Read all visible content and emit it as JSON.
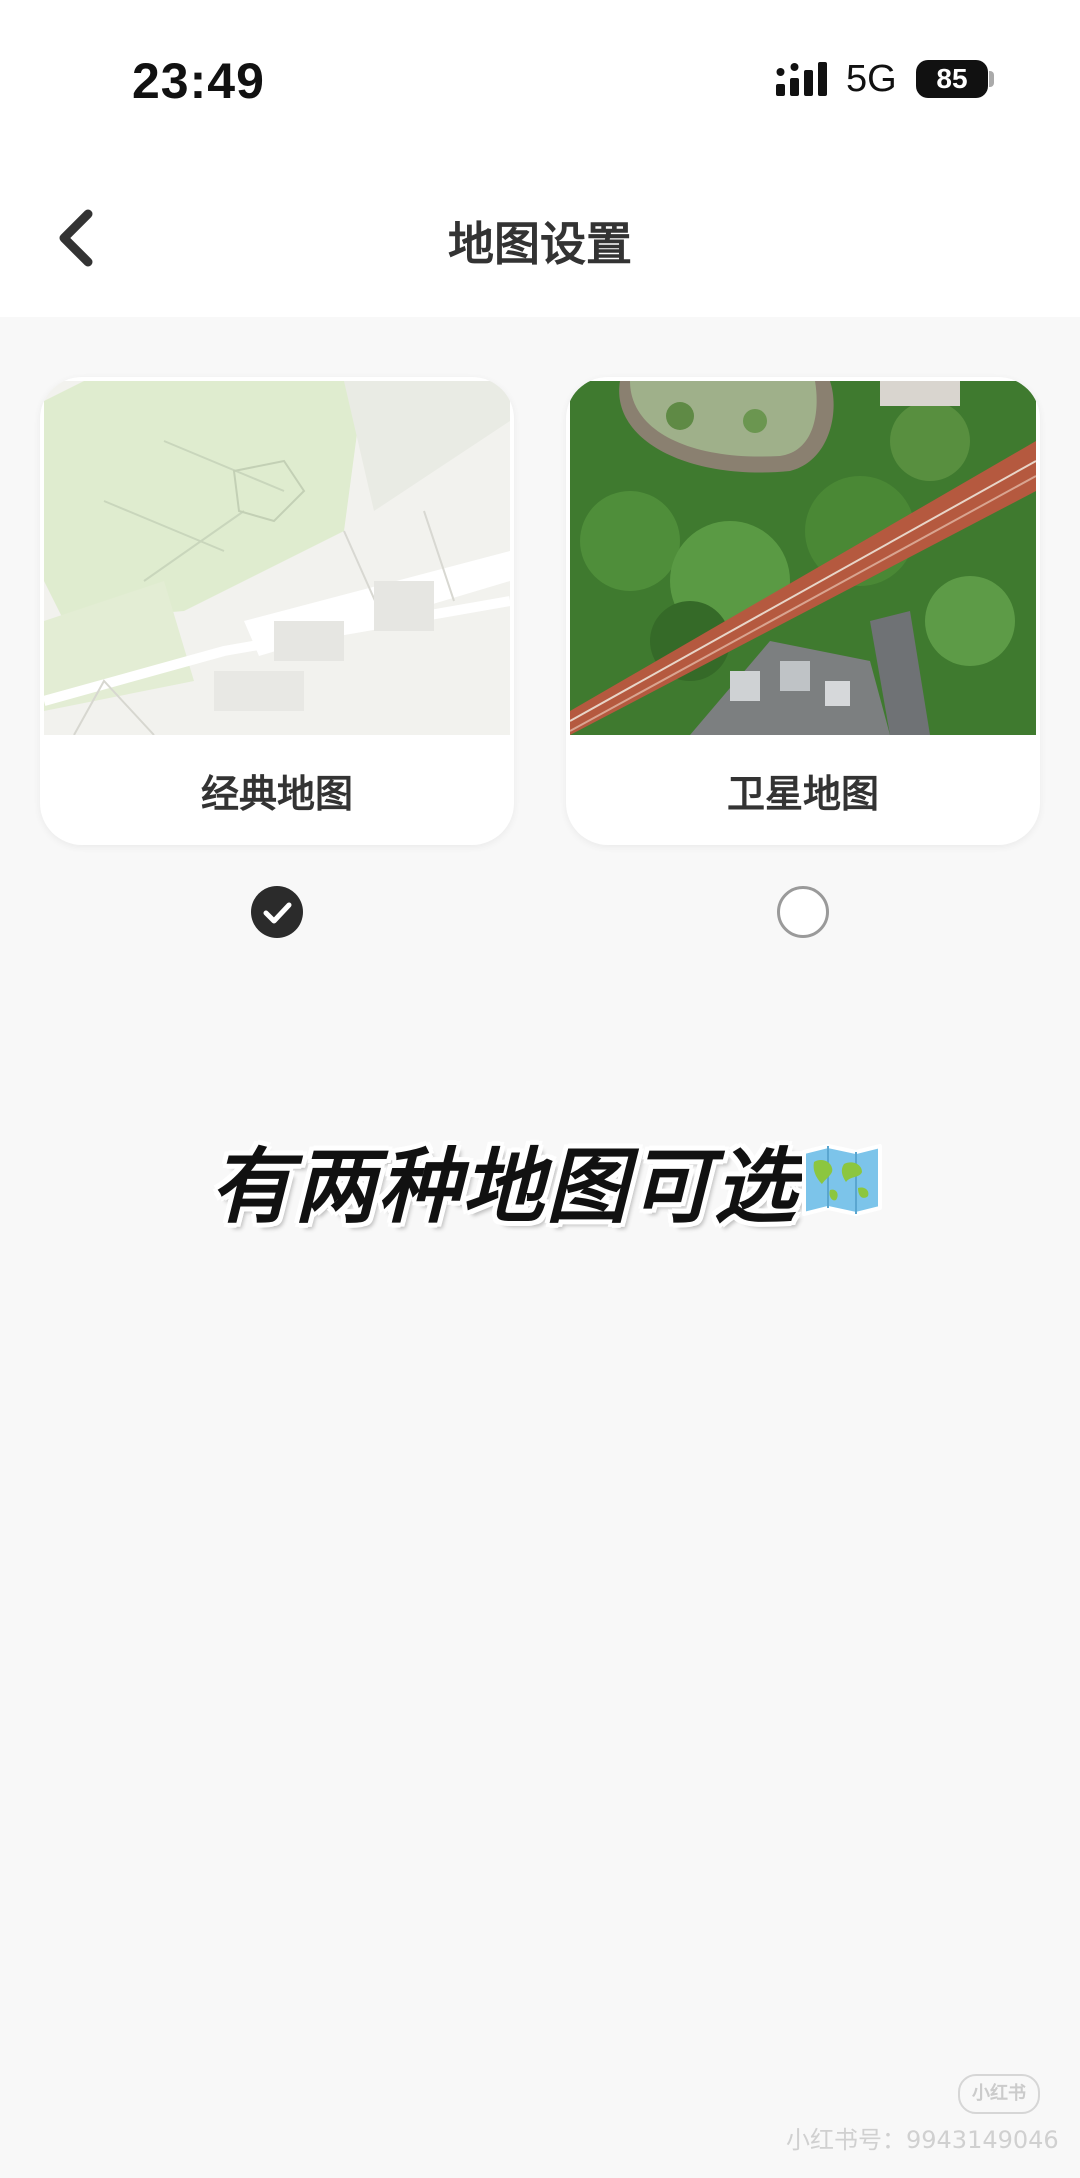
{
  "status_bar": {
    "time": "23:49",
    "network": "5G",
    "battery": "85"
  },
  "header": {
    "title": "地图设置"
  },
  "map_options": [
    {
      "label": "经典地图",
      "selected": true
    },
    {
      "label": "卫星地图",
      "selected": false
    }
  ],
  "overlay": {
    "caption": "有两种地图可选",
    "emoji_icon": "world-map-icon"
  },
  "watermark": {
    "logo": "小红书",
    "id_text": "小红书号：9943149046"
  },
  "colors": {
    "selected_radio": "#2b2b2b",
    "card_background": "#ffffff",
    "page_background": "#f8f8f8"
  }
}
